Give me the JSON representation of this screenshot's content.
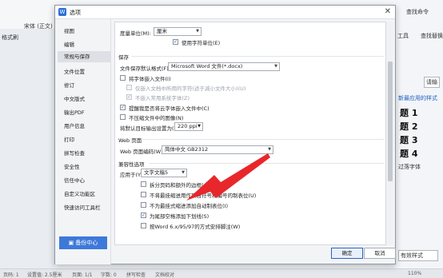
{
  "background": {
    "top_left_font": "宋体 (正文)",
    "top_left_label": "格式刷",
    "top_right_search": "查找命令",
    "top_right_tool1": "工具",
    "top_right_tool2": "查找替换",
    "right_field": "请输",
    "right_link": "新最应用的样式",
    "doc_heads": [
      "题 1",
      "题 2",
      "题 3",
      "题 4"
    ],
    "right_text": "过落字体",
    "right_bottom": "有效样式",
    "status_left": "页码: 1",
    "status_pages": "页面: 1/1",
    "status_setting": "设置值: 2.5厘米",
    "status_word": "字数: 0",
    "status_spell": "拼写检查",
    "status_doc": "文档校对",
    "status_zoom": "110%"
  },
  "dialog": {
    "title": "选项",
    "close": "✕",
    "nav": [
      "视图",
      "编辑",
      "常规与保存",
      "文件位置",
      "修订",
      "中文版式",
      "输出PDF",
      "用户信息",
      "打印",
      "拼写检查",
      "安全性",
      "信任中心",
      "自定义功能区",
      "快速访问工具栏"
    ],
    "nav_active": "常规与保存",
    "backup_button": "备份中心",
    "unit_label": "度量单位(M):",
    "unit_value": "厘米",
    "use_char_unit": "使用字符单位(E)",
    "save_section": "保存",
    "default_format_label": "文件保存默认格式(F):",
    "default_format_value": "Microsoft Word 文件(*.docx)",
    "embed_fonts": "将字体嵌入文件(I)",
    "embed_used_only": "仅嵌入文档中所用的字符(适于减小文件大小)(U)",
    "no_system_fonts": "不嵌入常用系统字体(Z)",
    "cloud_reminder": "提醒我是否将云字体嵌入文件中(C)",
    "no_compress_images": "不压缩文件中的图像(N)",
    "target_output_label": "将默认目标输出设置为(D):",
    "target_output_value": "220 ppi",
    "web_section": "Web 页面",
    "web_encoding_label": "Web 页面编码(W):",
    "web_encoding_value": "简体中文 GB2312",
    "compat_section": "兼容性选项",
    "apply_to_label": "应用于(Y):",
    "apply_to_value": "文字文稿5",
    "split_page": "拆分页码和额外的边框(A)",
    "no_split_table": "不将最挂缩进用作项目符号和编号的制表位(U)",
    "no_hanging_indent": "不为最挂式缩进添加自动制表位(I)",
    "underline_trailing": "为尾部空格添加下划线(S)",
    "word_layout": "按Word 6.x/95/97的方式安排脚注(W)",
    "ok": "确定",
    "cancel": "取消"
  },
  "colors": {
    "accent": "#3d79d9",
    "arrow": "#e8272c"
  }
}
